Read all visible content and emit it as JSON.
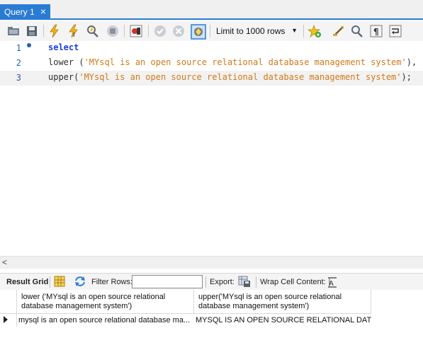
{
  "tab": {
    "label": "Query 1",
    "close": "×"
  },
  "toolbar": {
    "limit_label": "Limit to 1000 rows",
    "limit_arrow": "▼",
    "icons": [
      "folder-open-icon",
      "save-icon",
      "execute-icon",
      "execute-current-icon",
      "explain-icon",
      "stop-icon",
      "toggle-error-icon",
      "commit-icon",
      "rollback-icon",
      "autocommit-icon",
      "bookmark-icon",
      "beautify-icon",
      "find-icon",
      "invisible-chars-icon",
      "wrap-icon"
    ]
  },
  "editor": {
    "lines": [
      {
        "num": "1",
        "keyword": "select",
        "prefix": "",
        "string": "",
        "suffix": ""
      },
      {
        "num": "2",
        "keyword": "",
        "prefix": "lower (",
        "string": "'MYsql is an open source relational database management system'",
        "suffix": "),"
      },
      {
        "num": "3",
        "keyword": "",
        "prefix": "upper(",
        "string": "'MYsql is an open source relational database management system'",
        "suffix": ");"
      }
    ]
  },
  "scroll": {
    "left_arrow": "<"
  },
  "result_bar": {
    "result_grid": "Result Grid",
    "filter_rows": "Filter Rows:",
    "filter_value": "",
    "export": "Export:",
    "wrap": "Wrap Cell Content:"
  },
  "grid": {
    "columns": [
      {
        "line1": "lower ('MYsql is an open source relational",
        "line2": "database management system')"
      },
      {
        "line1": "upper('MYsql is an open source relational",
        "line2": "database management system')"
      }
    ],
    "rows": [
      [
        "mysql is an open source relational database ma...",
        "MYSQL IS AN OPEN SOURCE RELATIONAL DAT..."
      ]
    ]
  }
}
